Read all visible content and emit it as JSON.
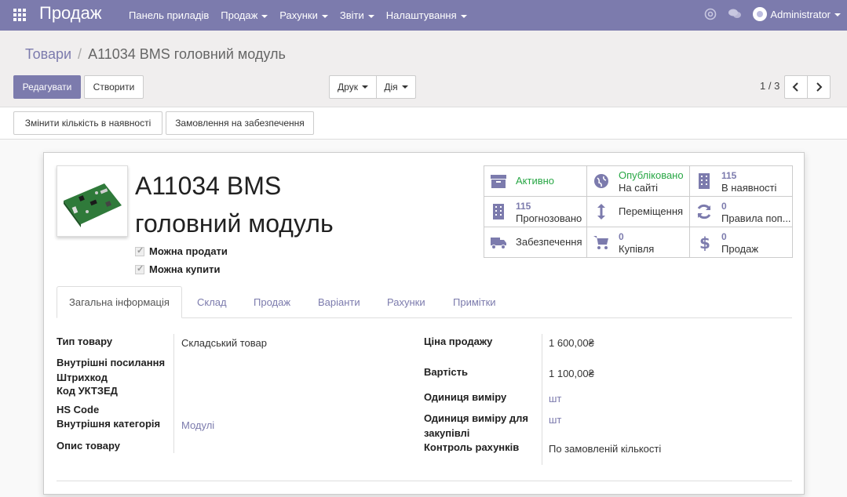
{
  "navbar": {
    "app_title": "Продаж",
    "menu": [
      "Панель приладів",
      "Продаж",
      "Рахунки",
      "Звіти",
      "Налаштування"
    ],
    "user": "Administrator"
  },
  "breadcrumb": {
    "parent": "Товари",
    "current": "A11034 BMS головний модуль"
  },
  "toolbar": {
    "edit": "Редагувати",
    "create": "Створити",
    "print": "Друк",
    "action": "Дія",
    "pager": "1 / 3"
  },
  "header_buttons": {
    "update_qty": "Змінити кількість в наявності",
    "replenish": "Замовлення на забезпечення"
  },
  "product": {
    "name_line1": "A11034 BMS",
    "name_line2": "головний модуль",
    "can_sell": "Можна продати",
    "can_buy": "Можна купити"
  },
  "stats": {
    "active": "Активно",
    "published": "Опубліковано",
    "on_site": "На сайті",
    "onhand_num": "115",
    "onhand": "В наявності",
    "forecast_num": "115",
    "forecast": "Прогнозовано",
    "moves": "Переміщення",
    "rules_num": "0",
    "rules": "Правила поп...",
    "replenish": "Забезпечення",
    "purchased_num": "0",
    "purchased": "Купівля",
    "sold_num": "0",
    "sold": "Продаж"
  },
  "tabs": [
    "Загальна інформація",
    "Склад",
    "Продаж",
    "Варіанти",
    "Рахунки",
    "Примітки"
  ],
  "fields_left": {
    "type_label": "Тип товару",
    "type_value": "Складський товар",
    "ref_label": "Внутрішні посилання",
    "barcode_label": "Штрихкод",
    "uktzed_label": "Код УКТЗЕД",
    "hs_label": "HS Code",
    "categ_label": "Внутрішня категорія",
    "categ_value": "Модулі",
    "desc_label": "Опис товару"
  },
  "fields_right": {
    "price_label": "Ціна продажу",
    "price_value": "1 600,00₴",
    "cost_label": "Вартість",
    "cost_value": "1 100,00₴",
    "uom_label": "Одиниця виміру",
    "uom_value": "шт",
    "po_uom_label_1": "Одиниця виміру для",
    "po_uom_label_2": "закупівлі",
    "po_uom_value": "шт",
    "invoice_label": "Контроль рахунків",
    "invoice_value": "По замовленій кількості"
  }
}
